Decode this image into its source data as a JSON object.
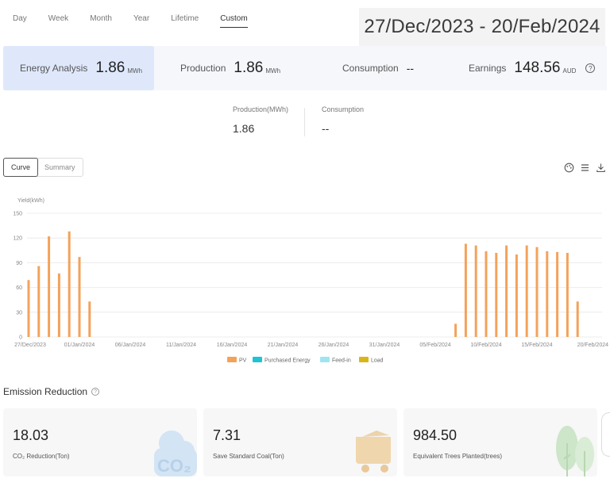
{
  "tabs": [
    "Day",
    "Week",
    "Month",
    "Year",
    "Lifetime",
    "Custom"
  ],
  "active_tab": "Custom",
  "date_range": "27/Dec/2023 - 20/Feb/2024",
  "summary": {
    "energy_label": "Energy Analysis",
    "energy_value": "1.86",
    "energy_unit": "MWh",
    "production_label": "Production",
    "production_value": "1.86",
    "production_unit": "MWh",
    "consumption_label": "Consumption",
    "consumption_value": "--",
    "earnings_label": "Earnings",
    "earnings_value": "148.56",
    "earnings_unit": "AUD",
    "help_glyph": "?"
  },
  "detail": {
    "production_label": "Production(MWh)",
    "production_value": "1.86",
    "consumption_label": "Consumption",
    "consumption_value": "--"
  },
  "view_toggle": {
    "curve": "Curve",
    "summary": "Summary"
  },
  "toolbar_icons": [
    "palette-icon",
    "list-icon",
    "download-icon"
  ],
  "chart_data": {
    "type": "bar",
    "ylabel": "Yield(kWh)",
    "ylim": [
      0,
      150
    ],
    "yticks": [
      0,
      30,
      60,
      90,
      120,
      150
    ],
    "xtick_labels": [
      "27/Dec/2023",
      "01/Jan/2024",
      "06/Jan/2024",
      "11/Jan/2024",
      "16/Jan/2024",
      "21/Jan/2024",
      "26/Jan/2024",
      "31/Jan/2024",
      "05/Feb/2024",
      "10/Feb/2024",
      "15/Feb/2024",
      "20/Feb/2024"
    ],
    "grid": true,
    "legend": [
      "PV",
      "Purchased Energy",
      "Feed-in",
      "Load"
    ],
    "legend_colors": [
      "#f4a25a",
      "#1ec3d6",
      "#9ee5ef",
      "#d9b51a"
    ],
    "legend_position": "bottom",
    "series": [
      {
        "name": "PV",
        "color": "#f4a25a",
        "values": [
          69,
          86,
          122,
          77,
          128,
          97,
          43,
          0,
          0,
          0,
          0,
          0,
          0,
          0,
          0,
          0,
          0,
          0,
          0,
          0,
          0,
          0,
          0,
          0,
          0,
          0,
          0,
          0,
          0,
          0,
          0,
          0,
          0,
          0,
          0,
          0,
          0,
          0,
          0,
          0,
          0,
          0,
          16,
          113,
          111,
          104,
          102,
          111,
          100,
          111,
          109,
          104,
          103,
          102,
          43
        ]
      }
    ]
  },
  "emission": {
    "title": "Emission Reduction",
    "help_glyph": "?",
    "cards": [
      {
        "value": "18.03",
        "label": "CO₂ Reduction(Ton)",
        "icon": "co2-cloud-icon"
      },
      {
        "value": "7.31",
        "label": "Save Standard Coal(Ton)",
        "icon": "coal-cart-icon"
      },
      {
        "value": "984.50",
        "label": "Equivalent Trees Planted(trees)",
        "icon": "trees-icon"
      }
    ],
    "co2_badge": "CO₂"
  }
}
